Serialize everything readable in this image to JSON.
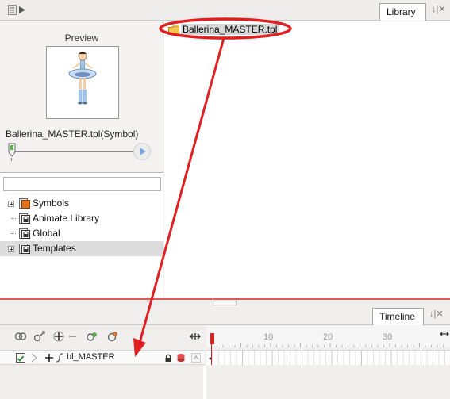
{
  "library": {
    "tab_label": "Library",
    "preview": {
      "title": "Preview",
      "symbol_name": "Ballerina_MASTER.tpl(Symbol)"
    },
    "tree": {
      "search_value": "",
      "items": [
        {
          "label": "Symbols",
          "expandable": true,
          "selected": false
        },
        {
          "label": "Animate Library",
          "expandable": false,
          "selected": false
        },
        {
          "label": "Global",
          "expandable": false,
          "selected": false
        },
        {
          "label": "Templates",
          "expandable": true,
          "selected": true
        }
      ]
    },
    "files": [
      {
        "label": "Ballerina_MASTER.tpl",
        "icon": "folder-icon",
        "highlighted": true
      }
    ]
  },
  "timeline": {
    "tab_label": "Timeline",
    "ruler": {
      "labels": [
        "10",
        "20",
        "30"
      ]
    },
    "layers": [
      {
        "name": "bl_MASTER",
        "enabled": true
      }
    ]
  },
  "colors": {
    "annotation": "#e02020",
    "selection": "#dcdcdc",
    "accent": "#3a7bd5"
  }
}
